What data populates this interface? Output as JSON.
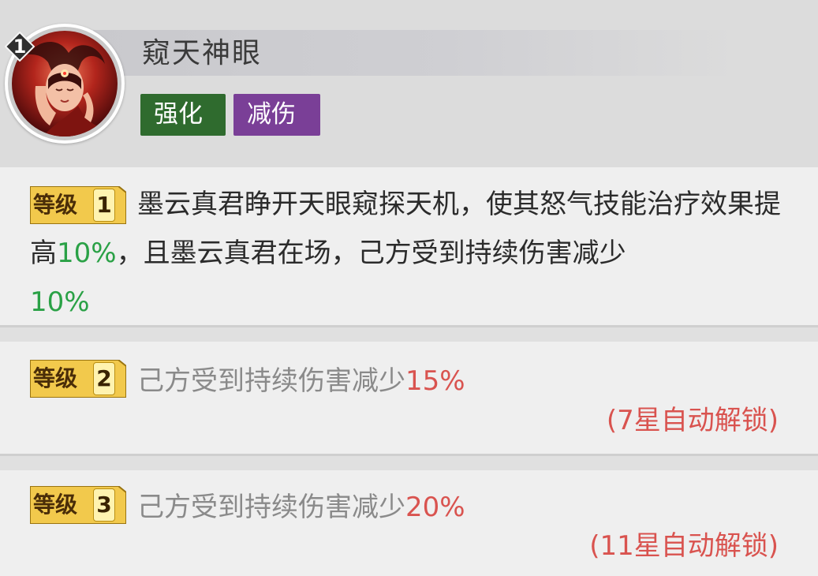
{
  "skill": {
    "index": "1",
    "title": "窥天神眼",
    "tags": [
      "强化",
      "减伤"
    ]
  },
  "levels": [
    {
      "badge_text": "等级",
      "badge_num": "1",
      "desc_part1": "墨云真君睁开天眼窥探天机，使其怒气技能治疗效果提高",
      "value1": "10%",
      "desc_part2": "，且墨云真君在场，己方受到持续伤害减少",
      "value2": "10%"
    },
    {
      "badge_text": "等级",
      "badge_num": "2",
      "desc": "己方受到持续伤害减少",
      "value": "15%",
      "unlock": "(7星自动解锁)"
    },
    {
      "badge_text": "等级",
      "badge_num": "3",
      "desc": "己方受到持续伤害减少",
      "value": "20%",
      "unlock": "(11星自动解锁)"
    }
  ],
  "colors": {
    "tag_green": "#2f6b2e",
    "tag_purple": "#7a3f97",
    "value_green": "#2aa146",
    "value_red": "#d9534f",
    "locked_text": "#8a8a8a",
    "level_badge": "#f2c94c"
  },
  "icons": {
    "portrait": "character-portrait",
    "index_badge": "diamond-badge-icon"
  }
}
